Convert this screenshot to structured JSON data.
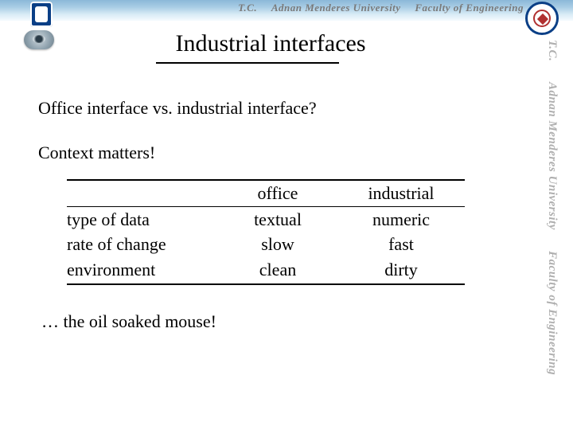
{
  "header": {
    "tc": "T.C.",
    "university": "Adnan Menderes University",
    "faculty": "Faculty of Engineering"
  },
  "sidebar": {
    "tc": "T.C.",
    "university": "Adnan Menderes University",
    "faculty": "Faculty of Engineering"
  },
  "title": "Industrial interfaces",
  "body": {
    "line1": "Office interface vs. industrial interface?",
    "line2": "Context matters!",
    "footer": "…  the oil soaked mouse!"
  },
  "table": {
    "head": {
      "label": "",
      "colA": "office",
      "colB": "industrial"
    },
    "rows": [
      {
        "label": "type of data",
        "colA": "textual",
        "colB": "numeric"
      },
      {
        "label": "rate of change",
        "colA": "slow",
        "colB": "fast"
      },
      {
        "label": "environment",
        "colA": "clean",
        "colB": "dirty"
      }
    ]
  }
}
